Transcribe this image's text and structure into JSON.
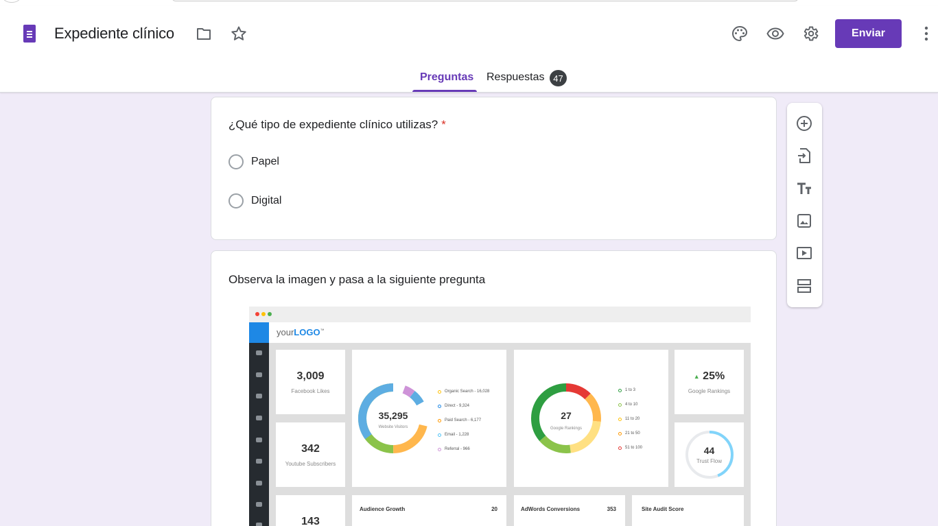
{
  "header": {
    "title": "Expediente clínico",
    "send_label": "Enviar",
    "tabs": [
      {
        "label": "Preguntas",
        "active": true
      },
      {
        "label": "Respuestas",
        "badge": "47"
      }
    ],
    "icons": [
      "forms-icon",
      "folder-icon",
      "star-icon",
      "palette-icon",
      "preview-eye-icon",
      "settings-gear-icon",
      "more-vert-icon"
    ]
  },
  "question": {
    "title": "¿Qué tipo de expediente clínico utilizas?",
    "required_mark": "*",
    "options": [
      "Papel",
      "Digital"
    ]
  },
  "section": {
    "text": "Observa la imagen y pasa a la siguiente pregunta"
  },
  "toolbar": {
    "icons": [
      "add-question-icon",
      "import-questions-icon",
      "add-title-icon",
      "add-image-icon",
      "add-video-icon",
      "add-section-icon"
    ]
  },
  "dashboard_image": {
    "logo_prefix": "your",
    "logo_bold": "LOGO",
    "logo_tm": "™",
    "facebook": {
      "value": "3,009",
      "label": "Facebook Likes"
    },
    "youtube": {
      "value": "342",
      "label": "Youtube Subscribers"
    },
    "third": {
      "value": "143"
    },
    "visitors": {
      "value": "35,295",
      "label": "Website Visitors",
      "legend": [
        "Organic Search - 16,028",
        "Direct - 9,324",
        "Paid Search - 6,177",
        "Email - 1,228",
        "Referral - 966"
      ]
    },
    "rankings": {
      "value": "27",
      "label": "Google Rankings",
      "legend": [
        "1 to 3",
        "4 to 10",
        "11 to 20",
        "21 to 50",
        "51 to 100"
      ]
    },
    "google_rank_change": {
      "value": "25%",
      "label": "Google Rankings"
    },
    "trust_flow": {
      "value": "44",
      "label": "Trust Flow"
    },
    "audience": {
      "label": "Audience Growth",
      "value": "20"
    },
    "adwords": {
      "label": "AdWords Conversions",
      "value": "353"
    },
    "audit": {
      "label": "Site Audit Score"
    },
    "colors": {
      "blue": "#1e88e5",
      "purple": "#673ab7"
    }
  }
}
